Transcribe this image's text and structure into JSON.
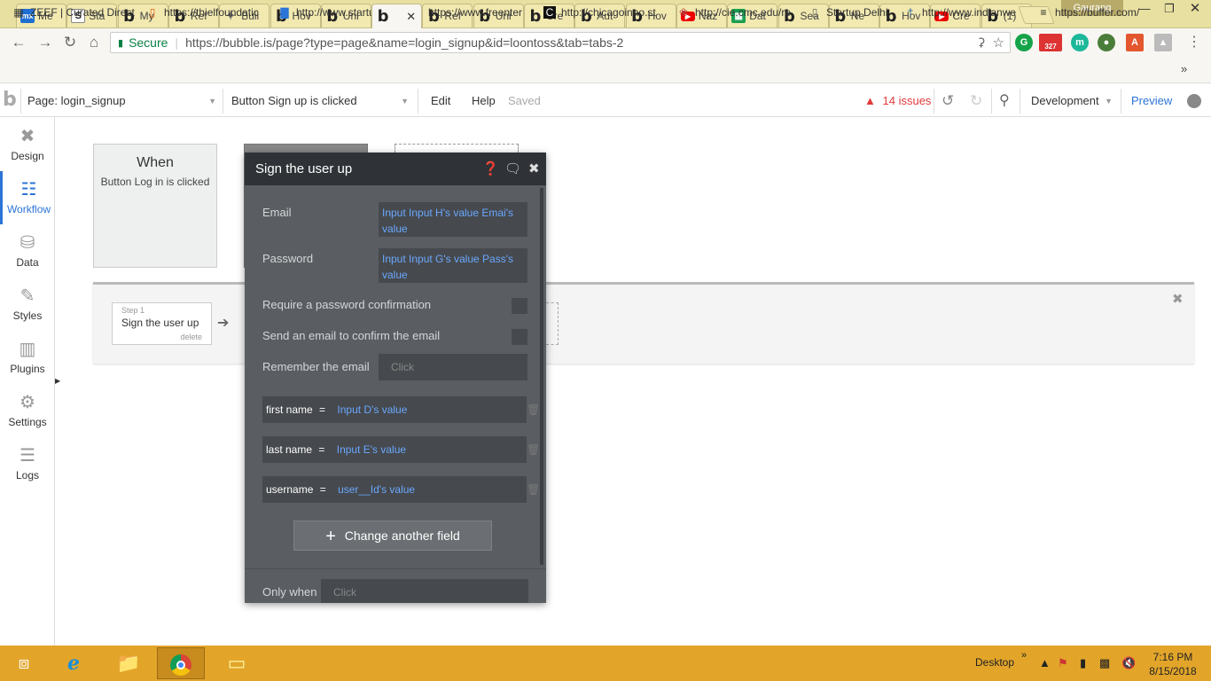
{
  "browser": {
    "tabs": [
      {
        "label": "Me",
        "fav": "mx"
      },
      {
        "label": "Sta",
        "fav": "s"
      },
      {
        "label": "My",
        "fav": "b"
      },
      {
        "label": "Ref",
        "fav": "b"
      },
      {
        "label": "Buil",
        "fav": "puz"
      },
      {
        "label": "Hov",
        "fav": "b"
      },
      {
        "label": "Uni",
        "fav": "b"
      },
      {
        "label": "",
        "fav": "b",
        "active": true
      },
      {
        "label": "Ref",
        "fav": "b"
      },
      {
        "label": "Uni",
        "fav": "b"
      },
      {
        "label": "Cre",
        "fav": "b"
      },
      {
        "label": "Aut",
        "fav": "b"
      },
      {
        "label": "Hov",
        "fav": "b"
      },
      {
        "label": "Naz",
        "fav": "yt"
      },
      {
        "label": "Dat",
        "fav": "sh"
      },
      {
        "label": "Sea",
        "fav": "b"
      },
      {
        "label": "Ne",
        "fav": "b"
      },
      {
        "label": "Hov",
        "fav": "b"
      },
      {
        "label": "Cre",
        "fav": "yt"
      },
      {
        "label": "(1)",
        "fav": "b"
      }
    ],
    "profile_name": "Gaurang",
    "address": {
      "secure_label": "Secure",
      "url": "https://bubble.is/page?type=page&name=login_signup&id=loontoss&tab=tabs-2"
    },
    "ext_badge": "327",
    "bookmarks": [
      "ZEEF | Curated Direct",
      "https://thielfoundatic",
      "http://www.startupra",
      "https://www.freenter",
      "http://chicagoinno.st",
      "http://cie.cmc.edu/re",
      "Startup Delhi",
      "http://www.indianwe",
      "https://buffer.com/"
    ]
  },
  "editor": {
    "page_select": "Page: login_signup",
    "event_select": "Button Sign up is clicked",
    "menu_edit": "Edit",
    "menu_help": "Help",
    "saved": "Saved",
    "issues": "14 issues",
    "env": "Development",
    "preview": "Preview",
    "nav": [
      {
        "label": "Design"
      },
      {
        "label": "Workflow",
        "active": true
      },
      {
        "label": "Data"
      },
      {
        "label": "Styles"
      },
      {
        "label": "Plugins"
      },
      {
        "label": "Settings"
      },
      {
        "label": "Logs"
      }
    ],
    "when_card": {
      "title": "When",
      "subtitle": "Button Log in is clicked"
    },
    "step": {
      "number": "Step 1",
      "title": "Sign the user up",
      "delete": "delete"
    }
  },
  "dialog": {
    "title": "Sign the user up",
    "email_label": "Email",
    "email_value": "Input Input H's value Emai's value",
    "password_label": "Password",
    "password_value": "Input Input G's value Pass's value",
    "require_pw_label": "Require a password confirmation",
    "send_email_label": "Send an email to confirm the email",
    "remember_label": "Remember the email",
    "click": "Click",
    "fields": [
      {
        "key": "first name",
        "eq": "=",
        "value": "Input D's value"
      },
      {
        "key": "last name",
        "eq": "=",
        "value": "Input E's value"
      },
      {
        "key": "username",
        "eq": "=",
        "value": "user__Id's value"
      }
    ],
    "change_btn": "Change another field",
    "only_when_label": "Only when"
  },
  "taskbar": {
    "desktop": "Desktop",
    "time": "7:16 PM",
    "date": "8/15/2018"
  }
}
